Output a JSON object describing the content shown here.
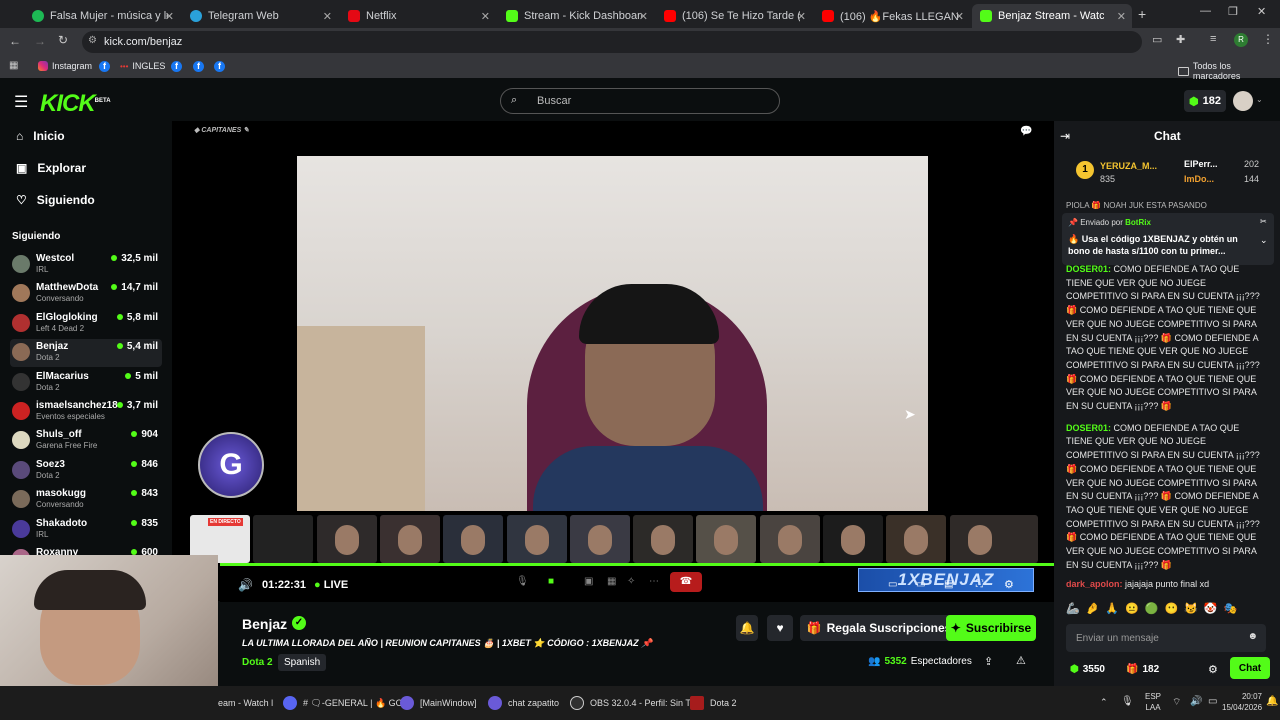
{
  "browser": {
    "tabs": [
      {
        "title": "Falsa Mujer - música y letra de",
        "color": "#1db954"
      },
      {
        "title": "Telegram Web",
        "color": "#2aa1da"
      },
      {
        "title": "Netflix",
        "color": "#e50914"
      },
      {
        "title": "Stream - Kick Dashboard",
        "color": "#53fc18"
      },
      {
        "title": "(106) Se Te Hizo Tarde (feat. El",
        "color": "#ff0000"
      },
      {
        "title": "(106) 🔥Fekas LLEGAN a Colo",
        "color": "#ff0000"
      },
      {
        "title": "Benjaz Stream - Watch Live",
        "color": "#53fc18"
      }
    ],
    "url": "kick.com/benjaz",
    "bookmarks": [
      {
        "label": "Instagram"
      },
      {
        "label": "INGLES"
      }
    ],
    "all_bookmarks": "Todos los marcadores",
    "profile_initial": "R"
  },
  "header": {
    "logo": "KICK",
    "logo_beta": "BETA",
    "search_placeholder": "Buscar",
    "points": "182"
  },
  "nav": {
    "home": "Inicio",
    "explore": "Explorar",
    "following": "Siguiendo",
    "section": "Siguiendo"
  },
  "following": [
    {
      "name": "Westcol",
      "game": "IRL",
      "viewers": "32,5 mil",
      "color": "#6a7a6a"
    },
    {
      "name": "MatthewDota",
      "game": "Conversando",
      "viewers": "14,7 mil",
      "color": "#a0785a"
    },
    {
      "name": "ElGlogloking",
      "game": "Left 4 Dead 2",
      "viewers": "5,8 mil",
      "color": "#b03030"
    },
    {
      "name": "Benjaz",
      "game": "Dota 2",
      "viewers": "5,4 mil",
      "color": "#8a6a55"
    },
    {
      "name": "ElMacarius",
      "game": "Dota 2",
      "viewers": "5 mil",
      "color": "#333333"
    },
    {
      "name": "ismaelsanchez18",
      "game": "Eventos especiales",
      "viewers": "3,7 mil",
      "color": "#cc2222"
    },
    {
      "name": "Shuls_off",
      "game": "Garena Free Fire",
      "viewers": "904",
      "color": "#ddd8c0"
    },
    {
      "name": "Soez3",
      "game": "Dota 2",
      "viewers": "846",
      "color": "#5a4a7a"
    },
    {
      "name": "masokugg",
      "game": "Conversando",
      "viewers": "843",
      "color": "#7a6a5a"
    },
    {
      "name": "Shakadoto",
      "game": "IRL",
      "viewers": "835",
      "color": "#4a3a9a"
    },
    {
      "name": "Roxanny",
      "game": "",
      "viewers": "600",
      "color": "#aa6688"
    }
  ],
  "player": {
    "overlay_title": "CAPITANES",
    "timer": "01:22:31",
    "live": "LIVE",
    "thumb_badge": "EN DIRECTO",
    "brand_overlay": "1XBENJAZ"
  },
  "stream": {
    "channel": "Benjaz",
    "title": "LA ULTIMA LLORADA DEL AÑO | REUNION CAPITANES 🎂 | 1XBET ⭐ CÓDIGO : 1XBENJAZ 📌",
    "category": "Dota 2",
    "language": "Spanish",
    "gift_label": "Regala Suscripciones",
    "subscribe_label": "Suscribirse",
    "viewers": "5352",
    "viewers_label": "Espectadores"
  },
  "chat": {
    "title": "Chat",
    "leaders": [
      {
        "rank": "1",
        "name": "YERUZA_M...",
        "score": "835"
      },
      {
        "name": "ElPerr...",
        "score": "202"
      },
      {
        "name": "ImDo...",
        "score": "144"
      }
    ],
    "truncated_line": "PIOLA 🎁 NOAH JUK ESTA PASANDO",
    "pinned_by": "Enviado por",
    "pinned_user": "BotRix",
    "pinned_text": "🔥 Usa el código 1XBENJAZ y obtén un bono de hasta s/1100 con tu primer...",
    "messages": [
      {
        "user": "DOSER01:",
        "text": " COMO DEFIENDE A TAO QUE TIENE QUE VER QUE NO JUEGE COMPETITIVO SI PARA EN SU CUENTA ¡¡¡??? 🎁 COMO DEFIENDE A TAO QUE TIENE QUE VER QUE NO JUEGE COMPETITIVO SI PARA EN SU CUENTA ¡¡¡??? 🎁 COMO DEFIENDE A TAO QUE TIENE QUE VER QUE NO JUEGE COMPETITIVO SI PARA EN SU CUENTA ¡¡¡??? 🎁 COMO DEFIENDE A TAO QUE TIENE QUE VER QUE NO JUEGE COMPETITIVO SI PARA EN SU CUENTA ¡¡¡??? 🎁"
      },
      {
        "user": "DOSER01:",
        "text": " COMO DEFIENDE A TAO QUE TIENE QUE VER QUE NO JUEGE COMPETITIVO SI PARA EN SU CUENTA ¡¡¡??? 🎁 COMO DEFIENDE A TAO QUE TIENE QUE VER QUE NO JUEGE COMPETITIVO SI PARA EN SU CUENTA ¡¡¡??? 🎁 COMO DEFIENDE A TAO QUE TIENE QUE VER QUE NO JUEGE COMPETITIVO SI PARA EN SU CUENTA ¡¡¡??? 🎁 COMO DEFIENDE A TAO QUE TIENE QUE VER QUE NO JUEGE COMPETITIVO SI PARA EN SU CUENTA ¡¡¡??? 🎁"
      },
      {
        "user": "dark_apolon:",
        "text": " jajajaja punto final xd",
        "user_color": "#e04a4a"
      }
    ],
    "input_placeholder": "Enviar un mensaje",
    "points_green": "3550",
    "points_gift": "182",
    "send_label": "Chat"
  },
  "taskbar": {
    "items": [
      {
        "label": "eam - Watch l"
      },
      {
        "label": "# 🗨-GENERAL | 🔥 GO"
      },
      {
        "label": "[MainWindow]"
      },
      {
        "label": "chat zapatito"
      },
      {
        "label": "OBS 32.0.4 - Perfil: Sin T"
      },
      {
        "label": "Dota 2"
      }
    ],
    "lang": "ESP",
    "region": "LAA",
    "time": "20:07",
    "date": "15/04/2026"
  }
}
